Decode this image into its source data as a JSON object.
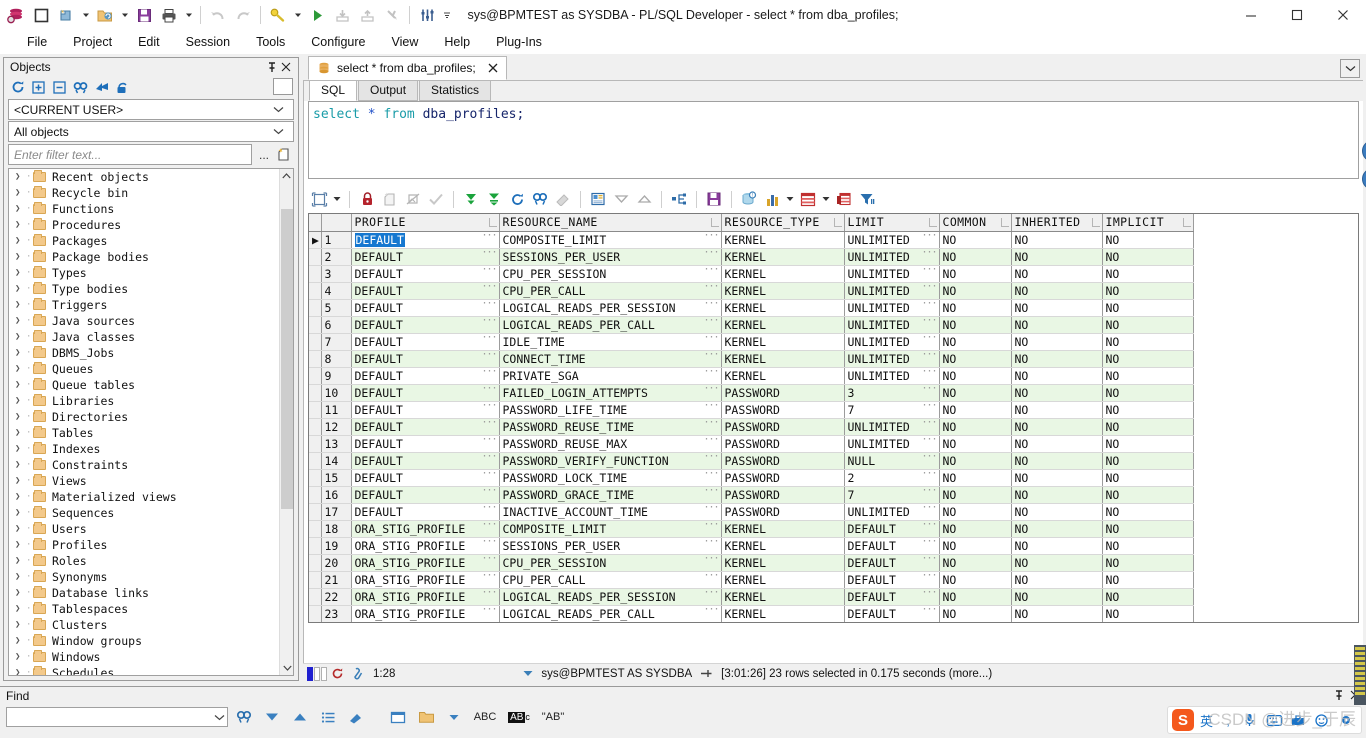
{
  "window": {
    "title": "sys@BPMTEST as SYSDBA - PL/SQL Developer - select * from dba_profiles;",
    "minimize": "—",
    "maximize": "▢",
    "close": "✕"
  },
  "menubar": {
    "items": [
      "File",
      "Project",
      "Edit",
      "Session",
      "Tools",
      "Configure",
      "View",
      "Help",
      "Plug-Ins"
    ]
  },
  "toolbar": {
    "icons": [
      "oracle-logo-icon",
      "new-window-icon",
      "new-file-icon",
      "new-file-dropdown",
      "open-file-icon",
      "open-file-dropdown",
      "save-icon",
      "print-icon",
      "print-dropdown",
      "undo-icon",
      "redo-icon",
      "find-icon",
      "find-dropdown",
      "execute-icon",
      "import-icon",
      "export-icon",
      "break-icon",
      "session-icon",
      "more-icon"
    ]
  },
  "objects_panel": {
    "title": "Objects",
    "pin_icon": "pin-icon",
    "close_icon": "close-icon",
    "toolbar_icons": [
      "refresh-icon",
      "expand-all-icon",
      "collapse-all-icon",
      "find-icon",
      "jump-icon",
      "lock-icon"
    ],
    "user_filter": "<CURRENT USER>",
    "object_filter": "All objects",
    "filter_placeholder": "Enter filter text...",
    "filter_value": "",
    "browse_label": "...",
    "new_filter_icon": "new-filter-icon",
    "tree": [
      "Recent objects",
      "Recycle bin",
      "Functions",
      "Procedures",
      "Packages",
      "Package bodies",
      "Types",
      "Type bodies",
      "Triggers",
      "Java sources",
      "Java classes",
      "DBMS_Jobs",
      "Queues",
      "Queue tables",
      "Libraries",
      "Directories",
      "Tables",
      "Indexes",
      "Constraints",
      "Views",
      "Materialized views",
      "Sequences",
      "Users",
      "Profiles",
      "Roles",
      "Synonyms",
      "Database links",
      "Tablespaces",
      "Clusters",
      "Window groups",
      "Windows",
      "Schedules"
    ]
  },
  "mdi": {
    "tab_label": "select * from dba_profiles;",
    "tab_icon": "database-icon",
    "tab_close": "✕",
    "window_list_arrow": "⌄"
  },
  "subtabs": {
    "items": [
      "SQL",
      "Output",
      "Statistics"
    ],
    "active": "SQL"
  },
  "sql_editor": {
    "tokens": [
      {
        "t": "select",
        "c": "kw"
      },
      {
        "t": " ",
        "c": "plain"
      },
      {
        "t": "*",
        "c": "star"
      },
      {
        "t": " ",
        "c": "plain"
      },
      {
        "t": "from",
        "c": "kw"
      },
      {
        "t": " ",
        "c": "plain"
      },
      {
        "t": "dba_profiles",
        "c": "ident"
      },
      {
        "t": ";",
        "c": "semi"
      }
    ],
    "full_text": "select * from dba_profiles;",
    "nav_up_icon": "scroll-up-icon",
    "nav_down_icon": "scroll-down-icon"
  },
  "grid_toolbar": {
    "icons": [
      "grid-view-icon",
      "grid-view-dropdown",
      "lock-record-icon",
      "insert-record-icon",
      "delete-record-icon",
      "post-changes-icon",
      "fetch-next-page-icon",
      "fetch-all-icon",
      "refresh-icon",
      "find-record-icon",
      "clear-filter-icon",
      "edit-data-icon",
      "sort-desc-icon",
      "sort-asc-icon",
      "split-icon",
      "export-save-icon",
      "copy-to-clipboard-icon",
      "chart-icon",
      "chart-dropdown",
      "grid-format-icon",
      "grid-format-dropdown",
      "duplicate-grid-icon",
      "filter-icon"
    ]
  },
  "grid": {
    "columns": [
      "PROFILE",
      "RESOURCE_NAME",
      "RESOURCE_TYPE",
      "LIMIT",
      "COMMON",
      "INHERITED",
      "IMPLICIT"
    ],
    "selected_row": 1,
    "selected_cell_value": "DEFAULT",
    "rows": [
      {
        "n": 1,
        "PROFILE": "DEFAULT",
        "RESOURCE_NAME": "COMPOSITE_LIMIT",
        "RESOURCE_TYPE": "KERNEL",
        "LIMIT": "UNLIMITED",
        "COMMON": "NO",
        "INHERITED": "NO",
        "IMPLICIT": "NO"
      },
      {
        "n": 2,
        "PROFILE": "DEFAULT",
        "RESOURCE_NAME": "SESSIONS_PER_USER",
        "RESOURCE_TYPE": "KERNEL",
        "LIMIT": "UNLIMITED",
        "COMMON": "NO",
        "INHERITED": "NO",
        "IMPLICIT": "NO"
      },
      {
        "n": 3,
        "PROFILE": "DEFAULT",
        "RESOURCE_NAME": "CPU_PER_SESSION",
        "RESOURCE_TYPE": "KERNEL",
        "LIMIT": "UNLIMITED",
        "COMMON": "NO",
        "INHERITED": "NO",
        "IMPLICIT": "NO"
      },
      {
        "n": 4,
        "PROFILE": "DEFAULT",
        "RESOURCE_NAME": "CPU_PER_CALL",
        "RESOURCE_TYPE": "KERNEL",
        "LIMIT": "UNLIMITED",
        "COMMON": "NO",
        "INHERITED": "NO",
        "IMPLICIT": "NO"
      },
      {
        "n": 5,
        "PROFILE": "DEFAULT",
        "RESOURCE_NAME": "LOGICAL_READS_PER_SESSION",
        "RESOURCE_TYPE": "KERNEL",
        "LIMIT": "UNLIMITED",
        "COMMON": "NO",
        "INHERITED": "NO",
        "IMPLICIT": "NO"
      },
      {
        "n": 6,
        "PROFILE": "DEFAULT",
        "RESOURCE_NAME": "LOGICAL_READS_PER_CALL",
        "RESOURCE_TYPE": "KERNEL",
        "LIMIT": "UNLIMITED",
        "COMMON": "NO",
        "INHERITED": "NO",
        "IMPLICIT": "NO"
      },
      {
        "n": 7,
        "PROFILE": "DEFAULT",
        "RESOURCE_NAME": "IDLE_TIME",
        "RESOURCE_TYPE": "KERNEL",
        "LIMIT": "UNLIMITED",
        "COMMON": "NO",
        "INHERITED": "NO",
        "IMPLICIT": "NO"
      },
      {
        "n": 8,
        "PROFILE": "DEFAULT",
        "RESOURCE_NAME": "CONNECT_TIME",
        "RESOURCE_TYPE": "KERNEL",
        "LIMIT": "UNLIMITED",
        "COMMON": "NO",
        "INHERITED": "NO",
        "IMPLICIT": "NO"
      },
      {
        "n": 9,
        "PROFILE": "DEFAULT",
        "RESOURCE_NAME": "PRIVATE_SGA",
        "RESOURCE_TYPE": "KERNEL",
        "LIMIT": "UNLIMITED",
        "COMMON": "NO",
        "INHERITED": "NO",
        "IMPLICIT": "NO"
      },
      {
        "n": 10,
        "PROFILE": "DEFAULT",
        "RESOURCE_NAME": "FAILED_LOGIN_ATTEMPTS",
        "RESOURCE_TYPE": "PASSWORD",
        "LIMIT": "3",
        "COMMON": "NO",
        "INHERITED": "NO",
        "IMPLICIT": "NO"
      },
      {
        "n": 11,
        "PROFILE": "DEFAULT",
        "RESOURCE_NAME": "PASSWORD_LIFE_TIME",
        "RESOURCE_TYPE": "PASSWORD",
        "LIMIT": "7",
        "COMMON": "NO",
        "INHERITED": "NO",
        "IMPLICIT": "NO"
      },
      {
        "n": 12,
        "PROFILE": "DEFAULT",
        "RESOURCE_NAME": "PASSWORD_REUSE_TIME",
        "RESOURCE_TYPE": "PASSWORD",
        "LIMIT": "UNLIMITED",
        "COMMON": "NO",
        "INHERITED": "NO",
        "IMPLICIT": "NO"
      },
      {
        "n": 13,
        "PROFILE": "DEFAULT",
        "RESOURCE_NAME": "PASSWORD_REUSE_MAX",
        "RESOURCE_TYPE": "PASSWORD",
        "LIMIT": "UNLIMITED",
        "COMMON": "NO",
        "INHERITED": "NO",
        "IMPLICIT": "NO"
      },
      {
        "n": 14,
        "PROFILE": "DEFAULT",
        "RESOURCE_NAME": "PASSWORD_VERIFY_FUNCTION",
        "RESOURCE_TYPE": "PASSWORD",
        "LIMIT": "NULL",
        "COMMON": "NO",
        "INHERITED": "NO",
        "IMPLICIT": "NO"
      },
      {
        "n": 15,
        "PROFILE": "DEFAULT",
        "RESOURCE_NAME": "PASSWORD_LOCK_TIME",
        "RESOURCE_TYPE": "PASSWORD",
        "LIMIT": "2",
        "COMMON": "NO",
        "INHERITED": "NO",
        "IMPLICIT": "NO"
      },
      {
        "n": 16,
        "PROFILE": "DEFAULT",
        "RESOURCE_NAME": "PASSWORD_GRACE_TIME",
        "RESOURCE_TYPE": "PASSWORD",
        "LIMIT": "7",
        "COMMON": "NO",
        "INHERITED": "NO",
        "IMPLICIT": "NO"
      },
      {
        "n": 17,
        "PROFILE": "DEFAULT",
        "RESOURCE_NAME": "INACTIVE_ACCOUNT_TIME",
        "RESOURCE_TYPE": "PASSWORD",
        "LIMIT": "UNLIMITED",
        "COMMON": "NO",
        "INHERITED": "NO",
        "IMPLICIT": "NO"
      },
      {
        "n": 18,
        "PROFILE": "ORA_STIG_PROFILE",
        "RESOURCE_NAME": "COMPOSITE_LIMIT",
        "RESOURCE_TYPE": "KERNEL",
        "LIMIT": "DEFAULT",
        "COMMON": "NO",
        "INHERITED": "NO",
        "IMPLICIT": "NO"
      },
      {
        "n": 19,
        "PROFILE": "ORA_STIG_PROFILE",
        "RESOURCE_NAME": "SESSIONS_PER_USER",
        "RESOURCE_TYPE": "KERNEL",
        "LIMIT": "DEFAULT",
        "COMMON": "NO",
        "INHERITED": "NO",
        "IMPLICIT": "NO"
      },
      {
        "n": 20,
        "PROFILE": "ORA_STIG_PROFILE",
        "RESOURCE_NAME": "CPU_PER_SESSION",
        "RESOURCE_TYPE": "KERNEL",
        "LIMIT": "DEFAULT",
        "COMMON": "NO",
        "INHERITED": "NO",
        "IMPLICIT": "NO"
      },
      {
        "n": 21,
        "PROFILE": "ORA_STIG_PROFILE",
        "RESOURCE_NAME": "CPU_PER_CALL",
        "RESOURCE_TYPE": "KERNEL",
        "LIMIT": "DEFAULT",
        "COMMON": "NO",
        "INHERITED": "NO",
        "IMPLICIT": "NO"
      },
      {
        "n": 22,
        "PROFILE": "ORA_STIG_PROFILE",
        "RESOURCE_NAME": "LOGICAL_READS_PER_SESSION",
        "RESOURCE_TYPE": "KERNEL",
        "LIMIT": "DEFAULT",
        "COMMON": "NO",
        "INHERITED": "NO",
        "IMPLICIT": "NO"
      },
      {
        "n": 23,
        "PROFILE": "ORA_STIG_PROFILE",
        "RESOURCE_NAME": "LOGICAL_READS_PER_CALL",
        "RESOURCE_TYPE": "KERNEL",
        "LIMIT": "DEFAULT",
        "COMMON": "NO",
        "INHERITED": "NO",
        "IMPLICIT": "NO"
      }
    ]
  },
  "statusbar": {
    "cursor_position": "1:28",
    "connection": "sys@BPMTEST AS SYSDBA",
    "result_message": "[3:01:26]  23 rows selected in 0.175 seconds (more...)",
    "session_icon": "session-icon",
    "user-icon": "user-icon",
    "pin_icon": "pin-icon",
    "dropdown_arrow": "▼"
  },
  "find_panel": {
    "title": "Find",
    "input_value": "",
    "pin_icon": "pin-icon",
    "close_icon": "close-icon",
    "icons": [
      "find-icon",
      "find-next-icon",
      "find-previous-icon",
      "find-list-icon",
      "clear-highlight-icon",
      "window-icon",
      "folder-icon",
      "folder-dropdown",
      "match-case-abc-icon",
      "whole-word-icon",
      "regex-icon"
    ],
    "abc_label": "ABC",
    "case_label": "AB",
    "regex_label": "\"AB\""
  },
  "ime": {
    "logo": "S",
    "lang": "英",
    "icons": [
      "comma-icon",
      "mic-icon",
      "keyboard-icon",
      "toolbox-icon",
      "smiley-icon",
      "settings-icon"
    ]
  },
  "watermark": "CSDN @进步_于辰"
}
